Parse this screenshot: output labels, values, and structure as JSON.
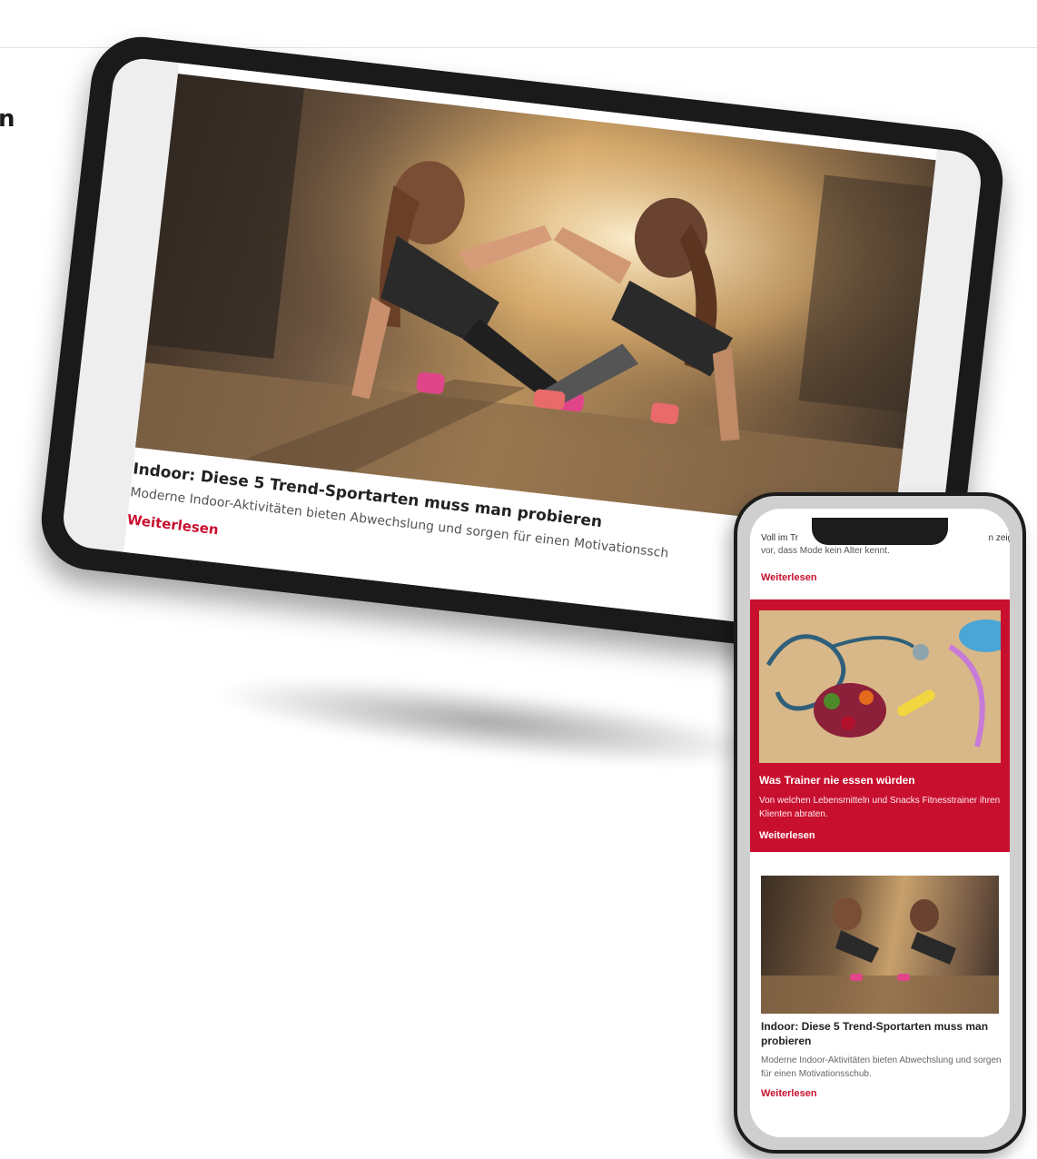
{
  "edge_text": "n",
  "tablet": {
    "featured": {
      "title": "Indoor: Diese 5 Trend-Sportarten muss man probieren",
      "description": "Moderne Indoor-Aktivitäten bieten Abwechslung und sorgen für einen Motivationssch",
      "read_more": "Weiterlesen"
    }
  },
  "phone": {
    "top_snippet": {
      "line1": "Voll im Tr",
      "line1_tail": "n zeigt",
      "line2": "vor, dass Mode kein Alter kennt.",
      "read_more": "Weiterlesen"
    },
    "red_card": {
      "title": "Was Trainer nie essen würden",
      "description": "Von welchen Lebensmitteln und Snacks Fitnesstrainer ihren Klienten abraten.",
      "read_more": "Weiterlesen"
    },
    "white_card": {
      "title": "Indoor: Diese 5 Trend-Sportarten muss man probieren",
      "description": "Moderne Indoor-Aktivitäten bieten Abwechslung und sorgen für einen Motivationsschub.",
      "read_more": "Weiterlesen"
    }
  },
  "colors": {
    "accent_red": "#c8102e",
    "device_black": "#1a1a1a"
  }
}
